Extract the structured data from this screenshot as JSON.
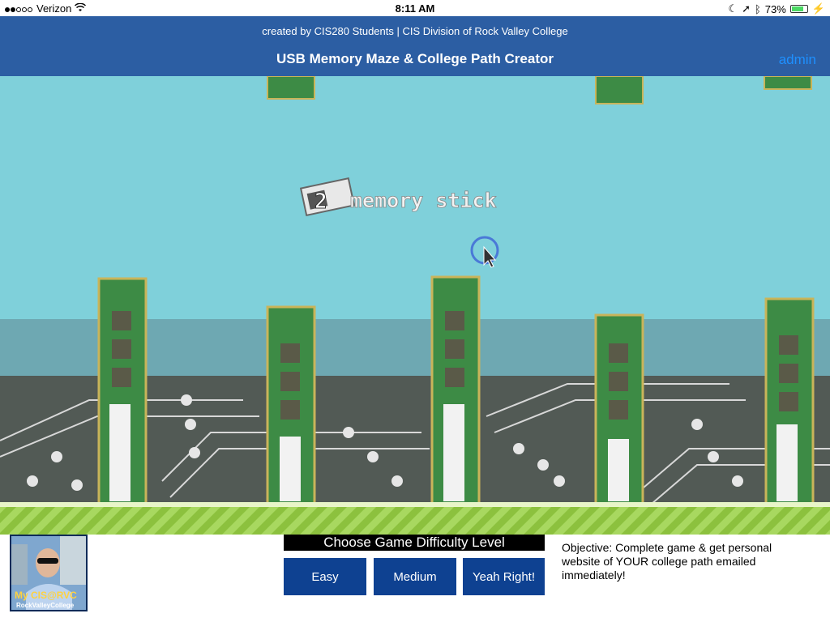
{
  "status_bar": {
    "carrier": "Verizon",
    "time": "8:11 AM",
    "battery": "73%"
  },
  "header": {
    "credit": "created by CIS280 Students | CIS Division of Rock Valley College",
    "title": "USB Memory Maze & College Path Creator",
    "admin_link": "admin"
  },
  "game": {
    "player_label": "memory stick",
    "score": "2"
  },
  "logo": {
    "line1": "My CIS@RVC",
    "line2": "RockValleyCollege"
  },
  "difficulty": {
    "heading": "Choose Game Difficulty Level",
    "buttons": [
      "Easy",
      "Medium",
      "Yeah Right!"
    ]
  },
  "objective": "Objective: Complete game & get personal website of YOUR college path emailed immediately!",
  "colors": {
    "header_bg": "#2c5ea3",
    "button_bg": "#0e4191",
    "sky": "#7fd0da",
    "ground_stripe": "#9ccc4f"
  }
}
